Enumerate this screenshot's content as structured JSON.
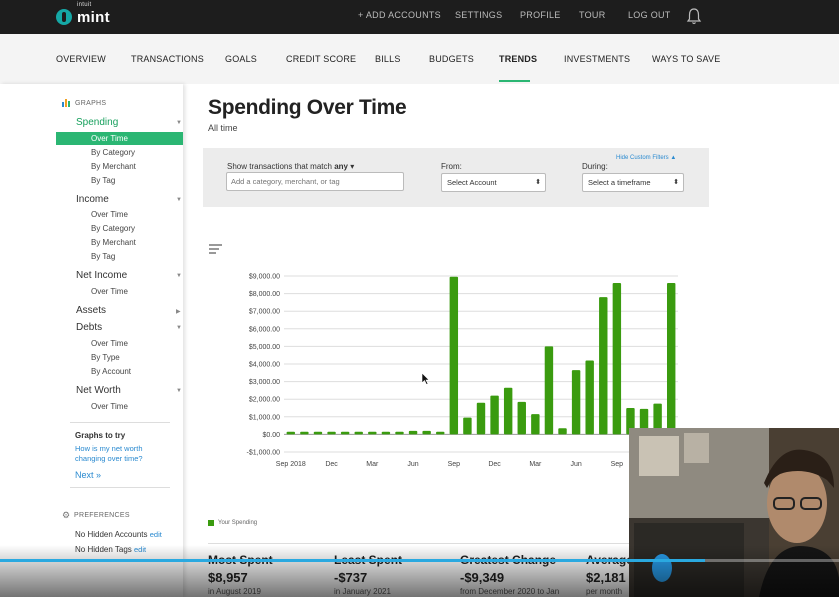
{
  "header": {
    "logo_small": "intuit",
    "logo_text": "mint",
    "links": [
      "+ ADD ACCOUNTS",
      "SETTINGS",
      "PROFILE",
      "TOUR",
      "LOG OUT"
    ]
  },
  "nav": {
    "items": [
      "OVERVIEW",
      "TRANSACTIONS",
      "GOALS",
      "CREDIT SCORE",
      "BILLS",
      "BUDGETS",
      "TRENDS",
      "INVESTMENTS",
      "WAYS TO SAVE"
    ],
    "active": "TRENDS"
  },
  "sidebar": {
    "graphs_heading": "GRAPHS",
    "groups": [
      {
        "label": "Spending",
        "subs": [
          "Over Time",
          "By Category",
          "By Merchant",
          "By Tag"
        ]
      },
      {
        "label": "Income",
        "subs": [
          "Over Time",
          "By Category",
          "By Merchant",
          "By Tag"
        ]
      },
      {
        "label": "Net Income",
        "subs": [
          "Over Time"
        ]
      },
      {
        "label": "Assets",
        "subs": []
      },
      {
        "label": "Debts",
        "subs": [
          "Over Time",
          "By Type",
          "By Account"
        ]
      },
      {
        "label": "Net Worth",
        "subs": [
          "Over Time"
        ]
      }
    ],
    "graphs_to_try": "Graphs to try",
    "try_link": "How is my net worth changing over time?",
    "next": "Next »",
    "preferences_heading": "PREFERENCES",
    "hidden_accounts": "No Hidden Accounts",
    "hidden_tags": "No Hidden Tags",
    "edit": "edit"
  },
  "main": {
    "title": "Spending Over Time",
    "subtitle": "All time"
  },
  "filters": {
    "hide_custom": "Hide Custom Filters",
    "match_label": "Show transactions that match",
    "match_value": "any",
    "search_placeholder": "Add a category, merchant, or tag",
    "from_label": "From:",
    "from_value": "Select Account",
    "during_label": "During:",
    "during_value": "Select a timeframe"
  },
  "legend": {
    "label": "Your Spending"
  },
  "stats": [
    {
      "label": "Most Spent",
      "value": "$8,957",
      "note": "in August 2019"
    },
    {
      "label": "Least Spent",
      "value": "-$737",
      "note": "in January 2021"
    },
    {
      "label": "Greatest Change",
      "value": "-$9,349",
      "note": "from December 2020 to Jan"
    },
    {
      "label": "Average",
      "value": "$2,181",
      "note": "per month"
    }
  ],
  "colors": {
    "accent": "#2bb673",
    "bar": "#3a9b0f",
    "link": "#2a8ad0"
  },
  "video_progress": 0.84,
  "chart_data": {
    "type": "bar",
    "ylim": [
      -1000,
      9000
    ],
    "yticks": [
      "$9,000.00",
      "$8,000.00",
      "$7,000.00",
      "$6,000.00",
      "$5,000.00",
      "$4,000.00",
      "$3,000.00",
      "$2,000.00",
      "$1,000.00",
      "$0.00",
      "-$1,000.00"
    ],
    "xtick_labels": [
      "Sep 2018",
      "Dec",
      "Mar",
      "Jun",
      "Sep",
      "Dec",
      "Mar",
      "Jun",
      "Sep"
    ],
    "series": [
      {
        "values": [
          150,
          150,
          150,
          150,
          150,
          150,
          150,
          150,
          150,
          200,
          200,
          150,
          8957,
          950,
          1800,
          2200,
          2650,
          1850,
          1150,
          5000,
          350,
          3650,
          4200,
          7800,
          8600,
          1500,
          1450,
          1750,
          8600
        ]
      }
    ]
  }
}
